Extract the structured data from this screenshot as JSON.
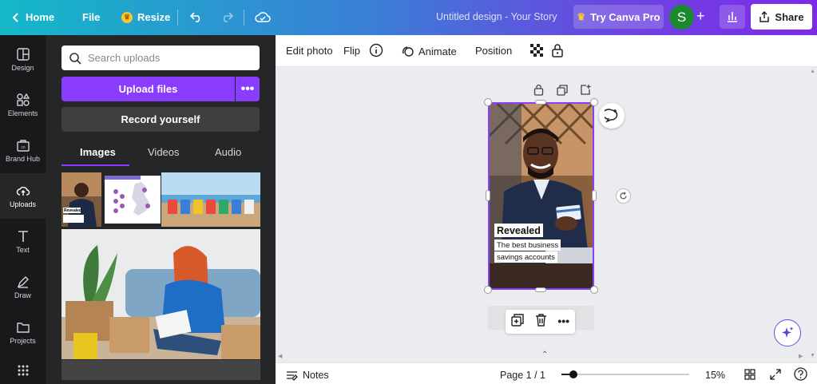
{
  "topbar": {
    "home": "Home",
    "file": "File",
    "resize": "Resize",
    "title": "Untitled design - Your Story",
    "try_pro": "Try Canva Pro",
    "avatar_letter": "S",
    "share": "Share"
  },
  "rail": {
    "items": [
      {
        "label": "Design",
        "icon": "layout-icon"
      },
      {
        "label": "Elements",
        "icon": "shapes-icon"
      },
      {
        "label": "Brand Hub",
        "icon": "brand-icon"
      },
      {
        "label": "Uploads",
        "icon": "cloud-upload-icon"
      },
      {
        "label": "Text",
        "icon": "text-icon"
      },
      {
        "label": "Draw",
        "icon": "draw-icon"
      },
      {
        "label": "Projects",
        "icon": "folder-icon"
      }
    ]
  },
  "panel": {
    "search_placeholder": "Search uploads",
    "upload_label": "Upload files",
    "record_label": "Record yourself",
    "tabs": [
      "Images",
      "Videos",
      "Audio"
    ],
    "thumb_revealed": "Revealed"
  },
  "toolbar": {
    "edit_photo": "Edit photo",
    "flip": "Flip",
    "animate": "Animate",
    "position": "Position"
  },
  "design": {
    "headline": "Revealed",
    "sub1": "The best business",
    "sub2": "savings accounts"
  },
  "bottombar": {
    "notes": "Notes",
    "page": "Page 1 / 1",
    "zoom_value": 15,
    "zoom": "15%"
  },
  "colors": {
    "accent": "#8b3dff",
    "rail_bg": "#18191b",
    "panel_bg": "#252627"
  }
}
